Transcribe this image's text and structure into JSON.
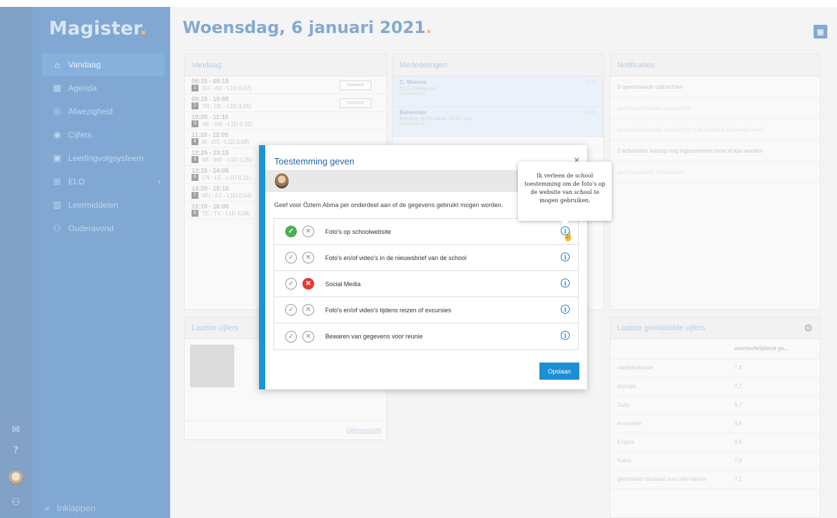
{
  "app": {
    "logo": "Magister"
  },
  "page": {
    "title": "Woensdag, 6 januari 2021"
  },
  "sidebar": {
    "items": [
      {
        "label": "Vandaag",
        "icon": "home-icon",
        "active": true
      },
      {
        "label": "Agenda",
        "icon": "calendar-icon"
      },
      {
        "label": "Afwezigheid",
        "icon": "check-circle-icon"
      },
      {
        "label": "Cijfers",
        "icon": "target-icon"
      },
      {
        "label": "Leerlingvolgsysteem",
        "icon": "id-card-icon"
      },
      {
        "label": "ELO",
        "icon": "network-icon",
        "has_submenu": true
      },
      {
        "label": "Leermiddelen",
        "icon": "books-icon"
      },
      {
        "label": "Ouderavond",
        "icon": "people-icon"
      }
    ],
    "collapse_label": "Inklappen"
  },
  "vandaag": {
    "title": "Vandaag",
    "lessons": [
      {
        "time": "08:25 - 09:15",
        "num": "1",
        "info": "DU - AD - L1D (L07)",
        "hw": "Huiswerk"
      },
      {
        "time": "09:15 - 10:05",
        "num": "2",
        "info": "TN - DE - L1D (L55)",
        "hw": "Huiswerk"
      },
      {
        "time": "10:20 - 11:10",
        "num": "3",
        "info": "NE - AW - L1D (L32)"
      },
      {
        "time": "11:10 - 12:05",
        "num": "4",
        "info": "BI - DS - L1D (L08)"
      },
      {
        "time": "12:25 - 13:15",
        "num": "5",
        "info": "WI - WR - L1D (L25)"
      },
      {
        "time": "13:15 - 14:05",
        "num": "6",
        "info": "CN - LE - L1D (L11)"
      },
      {
        "time": "14:20 - 15:10",
        "num": "7",
        "info": "MU - FZ - L1D (L04)"
      },
      {
        "time": "15:10 - 16:00",
        "num": "8",
        "info": "TE - TV - L1D (L09)"
      }
    ]
  },
  "mededelingen": {
    "title": "Mededelingen",
    "items": [
      {
        "from": "C. Wolono",
        "subject": "ELO inloop uur",
        "tag": "Mededeling",
        "time": "16:47"
      },
      {
        "from": "Beheerder",
        "subject": "Kantine dicht vanaf 14:00 uur!",
        "tag": "Mededeling",
        "time": "16:47"
      }
    ]
  },
  "notificaties": {
    "title": "Notificaties",
    "items": [
      {
        "text": "3 openstaande opdrachten",
        "dim": false
      },
      {
        "text": "geen beoordeelde opdrachten",
        "dim": true
      },
      {
        "text": "geen openstaande opdrachten met deadline komende week",
        "dim": true
      },
      {
        "text": "2 activiteiten waarop nog ingeschreven moet of kan worden",
        "dim": false
      },
      {
        "text": "geen ingelezen formulieren",
        "dim": true
      }
    ]
  },
  "laatste_cijfers": {
    "title": "Laatste cijfers",
    "footer_link": "Cijferoverzicht"
  },
  "gemiddelde_cijfers": {
    "title": "Laatste gemiddelde cijfers",
    "column_header": "voortschrijdend ge...",
    "rows": [
      {
        "subject": "aardrijkskunde",
        "grade": "7,8"
      },
      {
        "subject": "biologie",
        "grade": "7,7"
      },
      {
        "subject": "Duits",
        "grade": "6,7"
      },
      {
        "subject": "economie",
        "grade": "6,6"
      },
      {
        "subject": "Engels",
        "grade": "6,8"
      },
      {
        "subject": "Frans",
        "grade": "7,0"
      },
      {
        "subject": "gemiddeld resultaat over alle vakken",
        "grade": "7,1"
      }
    ]
  },
  "modal": {
    "title": "Toestemming geven",
    "close": "×",
    "description": "Geef voor Özlem Abma per onderdeel aan of de gegevens gebruikt mogen worden.",
    "items": [
      {
        "label": "Foto's op schoolwebsite",
        "state": "yes"
      },
      {
        "label": "Foto's en/of video's in de nieuwsbrief van de school",
        "state": "none"
      },
      {
        "label": "Social Media",
        "state": "no"
      },
      {
        "label": "Foto's en/of video's tijdens reizen of excursies",
        "state": "none"
      },
      {
        "label": "Bewaren van gegevens voor reunie",
        "state": "none"
      }
    ],
    "save_label": "Opslaan",
    "tooltip": "Ik verleen de school toestemming om de foto's op de website van school te mogen gebruiken."
  }
}
